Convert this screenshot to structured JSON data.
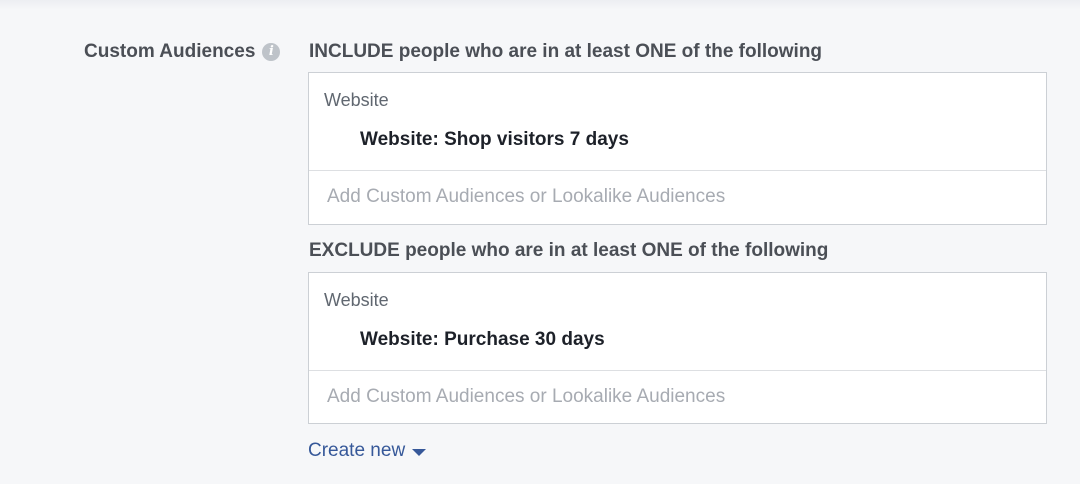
{
  "custom_audiences": {
    "label": "Custom Audiences",
    "info_icon_glyph": "i",
    "include": {
      "heading": "INCLUDE people who are in at least ONE of the following",
      "group_label": "Website",
      "selected": "Website: Shop visitors 7 days",
      "placeholder": "Add Custom Audiences or Lookalike Audiences"
    },
    "exclude": {
      "heading": "EXCLUDE people who are in at least ONE of the following",
      "group_label": "Website",
      "selected": "Website: Purchase 30 days",
      "placeholder": "Add Custom Audiences or Lookalike Audiences"
    },
    "create_new_label": "Create new"
  },
  "colors": {
    "background": "#f6f7f9",
    "link": "#365899",
    "label": "#4b4f56",
    "placeholder": "#a7abb2",
    "border": "#ccd0d5"
  },
  "icons": {
    "info": "info-icon",
    "dropdown": "caret-down-icon"
  }
}
